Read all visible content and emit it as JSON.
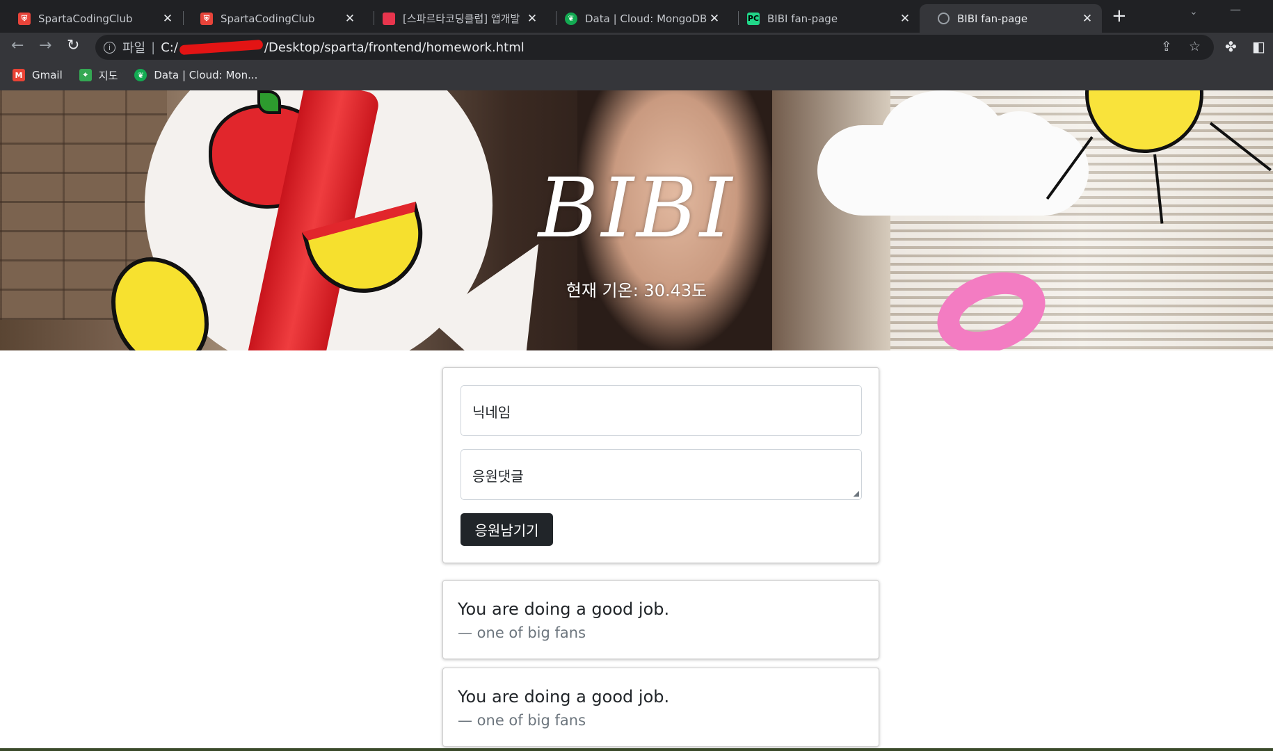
{
  "browser": {
    "tabs": [
      {
        "title": "SpartaCodingClub",
        "favicon_color": "#e8443a",
        "active": false
      },
      {
        "title": "SpartaCodingClub",
        "favicon_color": "#e8443a",
        "active": false
      },
      {
        "title": "[스파르타코딩클럽] 앱개발",
        "favicon_color": "#e8354d",
        "active": false
      },
      {
        "title": "Data | Cloud: MongoDB Cl",
        "favicon_color": "#13aa52",
        "active": false
      },
      {
        "title": "BIBI fan-page",
        "favicon_color": "#21d789",
        "active": false
      },
      {
        "title": "BIBI fan-page",
        "favicon_color": "#9aa0a6",
        "active": true
      }
    ],
    "address": {
      "scheme_label": "파일",
      "url_prefix": "C:/",
      "url_suffix": "/Desktop/sparta/frontend/homework.html"
    },
    "bookmarks": [
      {
        "label": "Gmail",
        "icon": "gmail-icon",
        "color": "#ea4335"
      },
      {
        "label": "지도",
        "icon": "maps-icon",
        "color": "#34a853"
      },
      {
        "label": "Data | Cloud: Mon...",
        "icon": "mongodb-leaf-icon",
        "color": "#13aa52"
      }
    ]
  },
  "hero": {
    "title": "BIBI",
    "weather": "현재 기온: 30.43도"
  },
  "form": {
    "nickname_placeholder": "닉네임",
    "comment_placeholder": "응원댓글",
    "submit_label": "응원남기기"
  },
  "comments": [
    {
      "text": "You are doing a good job.",
      "author": "— one of big fans"
    },
    {
      "text": "You are doing a good job.",
      "author": "— one of big fans"
    }
  ]
}
